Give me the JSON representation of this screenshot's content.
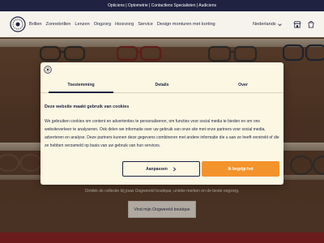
{
  "topbar": {
    "text": "Opticiens | Optometrie | Contactlens Specialisten | Audiciens"
  },
  "header": {
    "nav": [
      {
        "label": "Brillen"
      },
      {
        "label": "Zonnebrillen"
      },
      {
        "label": "Lenzen"
      },
      {
        "label": "Oogzorg"
      },
      {
        "label": "Hoorzorg"
      },
      {
        "label": "Service"
      },
      {
        "label": "Design monturen met korting"
      }
    ],
    "language": "Nederlands",
    "icons": [
      "logo-icon",
      "chevron-down-icon",
      "store-icon",
      "cart-icon"
    ]
  },
  "hero": {
    "subtitle": "Ontdek de collectie bij jouw Oogwereld boutique, unieke merken en de beste oogzorg.",
    "button_label": "Vind mijn Oogwereld boutique"
  },
  "cookie_dialog": {
    "tabs": [
      {
        "label": "Toestemming",
        "active": true
      },
      {
        "label": "Details",
        "active": false
      },
      {
        "label": "Over",
        "active": false
      }
    ],
    "heading": "Deze website maakt gebruik van cookies",
    "body": "We gebruiken cookies om content en advertenties te personaliseren, om functies voor social media te bieden en om ons websiteverkeer te analyseren. Ook delen we informatie over uw gebruik van onze site met onze partners voor social media, adverteren en analyse. Deze partners kunnen deze gegevens combineren met andere informatie die u aan ze heeft verstrekt of die ze hebben verzameld op basis van uw gebruik van hun services.",
    "customize_label": "Aanpassen",
    "accept_label": "Ik begrijp het",
    "colors": {
      "accept": "#f3932c",
      "text": "#1f2240",
      "background": "#fbf7e3"
    }
  }
}
